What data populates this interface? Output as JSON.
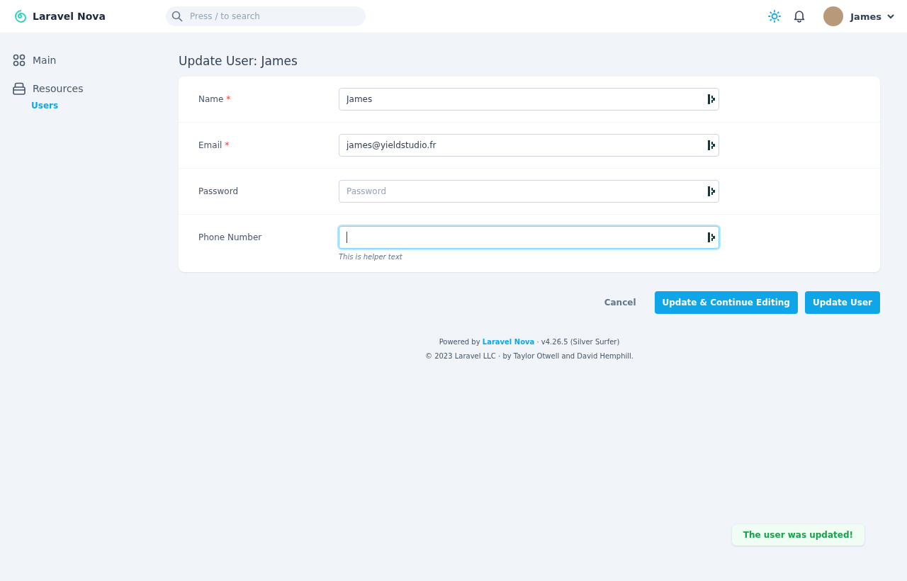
{
  "header": {
    "brand": "Laravel Nova",
    "search": {
      "placeholder": "Press / to search"
    },
    "user": {
      "name": "James"
    }
  },
  "sidebar": {
    "items": [
      {
        "label": "Main"
      },
      {
        "label": "Resources",
        "children": [
          {
            "label": "Users",
            "selected": true
          }
        ]
      }
    ]
  },
  "page_title": "Update User: James",
  "fields": [
    {
      "label": "Name",
      "required_mark": "*",
      "value": "James",
      "focused": false
    },
    {
      "label": "Email",
      "required_mark": "*",
      "value": "james@yieldstudio.fr",
      "focused": false
    },
    {
      "label": "Password",
      "placeholder": "Password",
      "focused": false
    },
    {
      "label": "Phone Number",
      "focused": true,
      "helper": "This is helper text"
    }
  ],
  "actions": {
    "cancel": "Cancel",
    "buttons": [
      "Update & Continue Editing",
      "Update User"
    ]
  },
  "footer": {
    "powered_prefix": "Powered by",
    "powered_link": "Laravel Nova",
    "powered_suffix": "· v4.26.5 (Silver Surfer)",
    "copyright": "© 2023 Laravel LLC · by Taylor Otwell and David Hemphill."
  },
  "toast": {
    "message": "The user was updated!"
  }
}
